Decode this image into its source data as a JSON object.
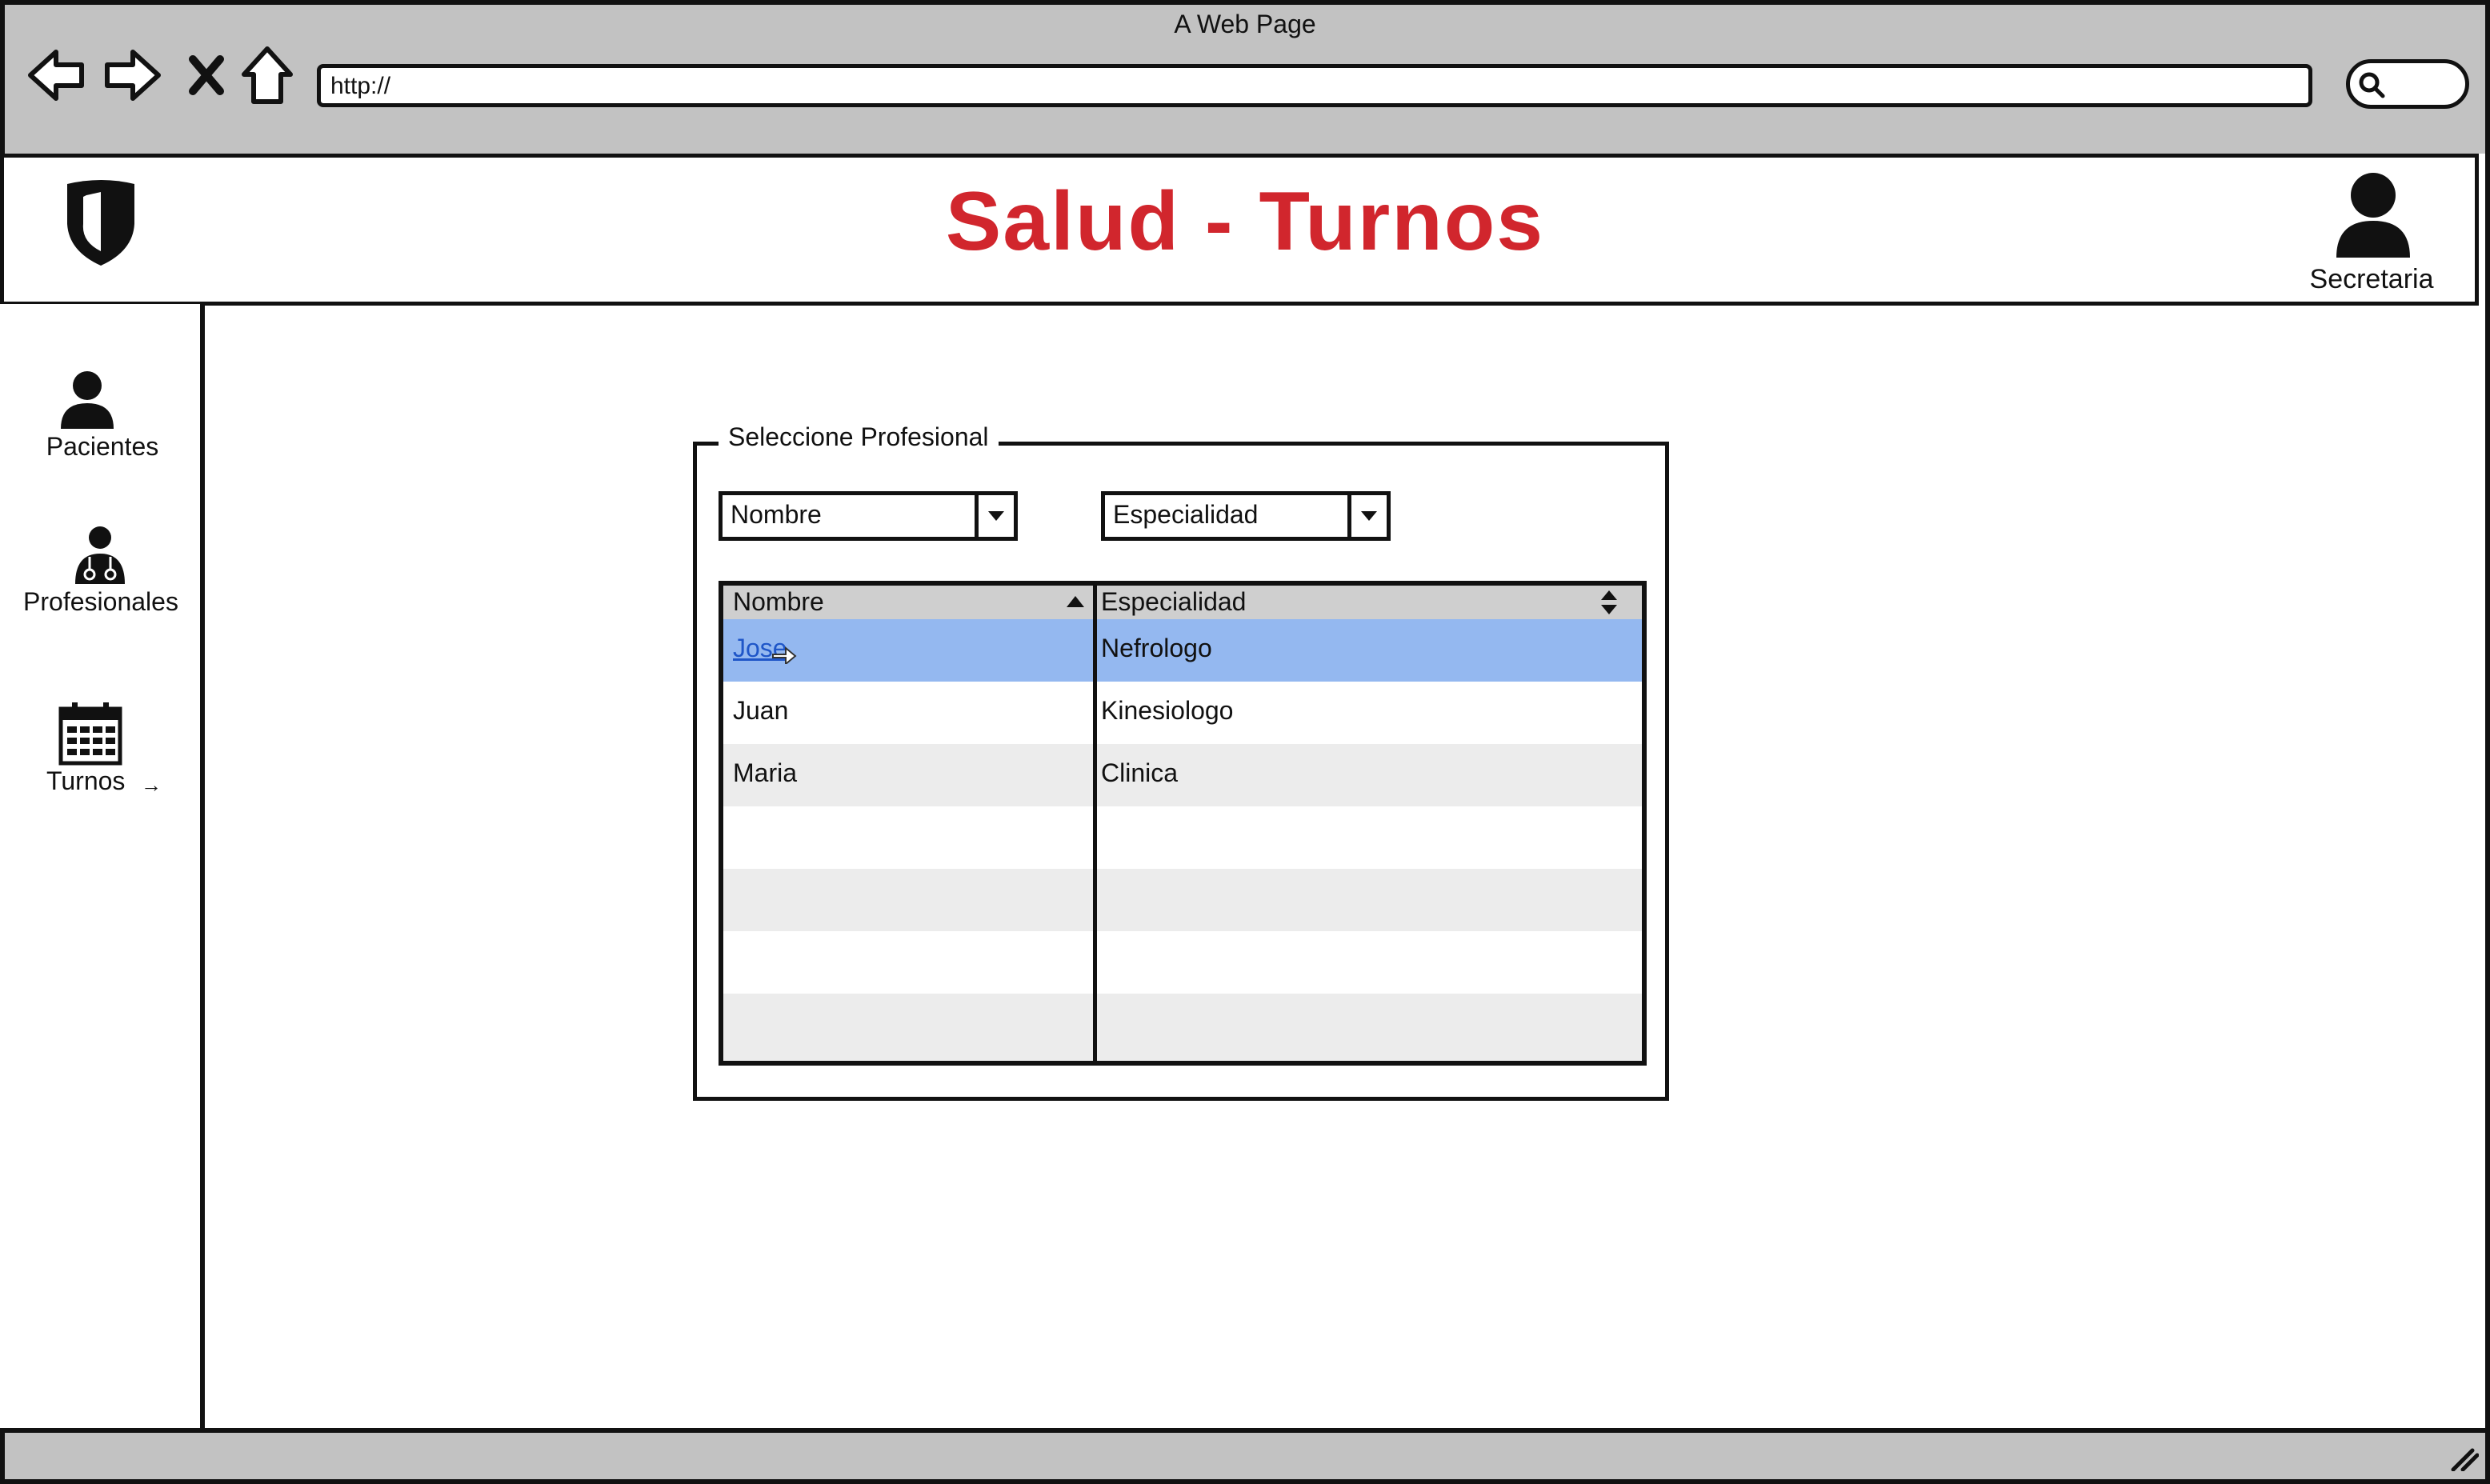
{
  "browser": {
    "window_title": "A Web Page",
    "url": "http://",
    "nav_icons": [
      "back-arrow-icon",
      "forward-arrow-icon",
      "close-x-icon",
      "home-icon"
    ],
    "search_icon": "search-icon"
  },
  "header": {
    "title": "Salud - Turnos",
    "title_color": "#d1262d",
    "logo_icon": "shield-icon",
    "user_label": "Secretaria",
    "user_icon": "user-icon"
  },
  "sidebar": {
    "items": [
      {
        "label": "Pacientes",
        "icon": "patient-icon"
      },
      {
        "label": "Profesionales",
        "icon": "doctor-icon"
      },
      {
        "label": "Turnos",
        "icon": "calendar-icon",
        "suffix": "→"
      }
    ]
  },
  "form": {
    "legend": "Seleccione Profesional",
    "filter_name": "Nombre",
    "filter_specialty": "Especialidad",
    "table": {
      "headers": [
        "Nombre",
        "Especialidad"
      ],
      "rows": [
        {
          "nombre": "Jose",
          "especialidad": "Nefrologo",
          "selected": true
        },
        {
          "nombre": "Juan",
          "especialidad": "Kinesiologo",
          "selected": false
        },
        {
          "nombre": "Maria",
          "especialidad": "Clinica",
          "selected": false
        }
      ],
      "selected_color": "#94b8f0",
      "alt_row_color": "#ececec"
    }
  }
}
